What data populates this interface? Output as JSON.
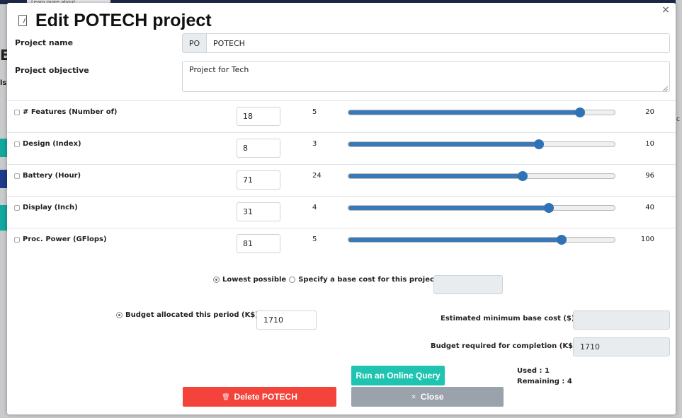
{
  "background": {
    "tab_text": "Learn more about",
    "left_text_large": "EA",
    "left_text_small": "ls",
    "right_text": "c"
  },
  "modal": {
    "title": "Edit POTECH project",
    "project_name_label": "Project name",
    "project_name_prefix": "PO",
    "project_name_value": "POTECH",
    "project_objective_label": "Project objective",
    "project_objective_value": "Project for Tech"
  },
  "attributes": [
    {
      "label": "# Features (Number of)",
      "icon": "features-icon",
      "value": "18",
      "min": 5,
      "max": 20
    },
    {
      "label": "Design (Index)",
      "icon": "design-icon",
      "value": "8",
      "min": 3,
      "max": 10
    },
    {
      "label": "Battery (Hour)",
      "icon": "battery-icon",
      "value": "71",
      "min": 24,
      "max": 96
    },
    {
      "label": "Display (Inch)",
      "icon": "display-icon",
      "value": "31",
      "min": 4,
      "max": 40
    },
    {
      "label": "Proc. Power (GFlops)",
      "icon": "processor-icon",
      "value": "81",
      "min": 5,
      "max": 100
    }
  ],
  "cost": {
    "lowest_label": "Lowest possible",
    "specify_label": "Specify a base cost for this project",
    "base_cost_value": "",
    "budget_label": "Budget allocated this period (K$)",
    "budget_value": "1710",
    "est_min_label": "Estimated minimum base cost ($)",
    "est_min_value": "",
    "required_label": "Budget required for completion (K$):",
    "required_value": "1710"
  },
  "actions": {
    "query_label": "Run an Online Query",
    "delete_label": "Delete POTECH",
    "close_label": "Close",
    "used_text": "Used : 1",
    "remaining_text": "Remaining : 4"
  },
  "colors": {
    "slider": "#3a78b8",
    "query": "#1fc4b0",
    "delete": "#f4433a",
    "close": "#9aa2ab"
  }
}
